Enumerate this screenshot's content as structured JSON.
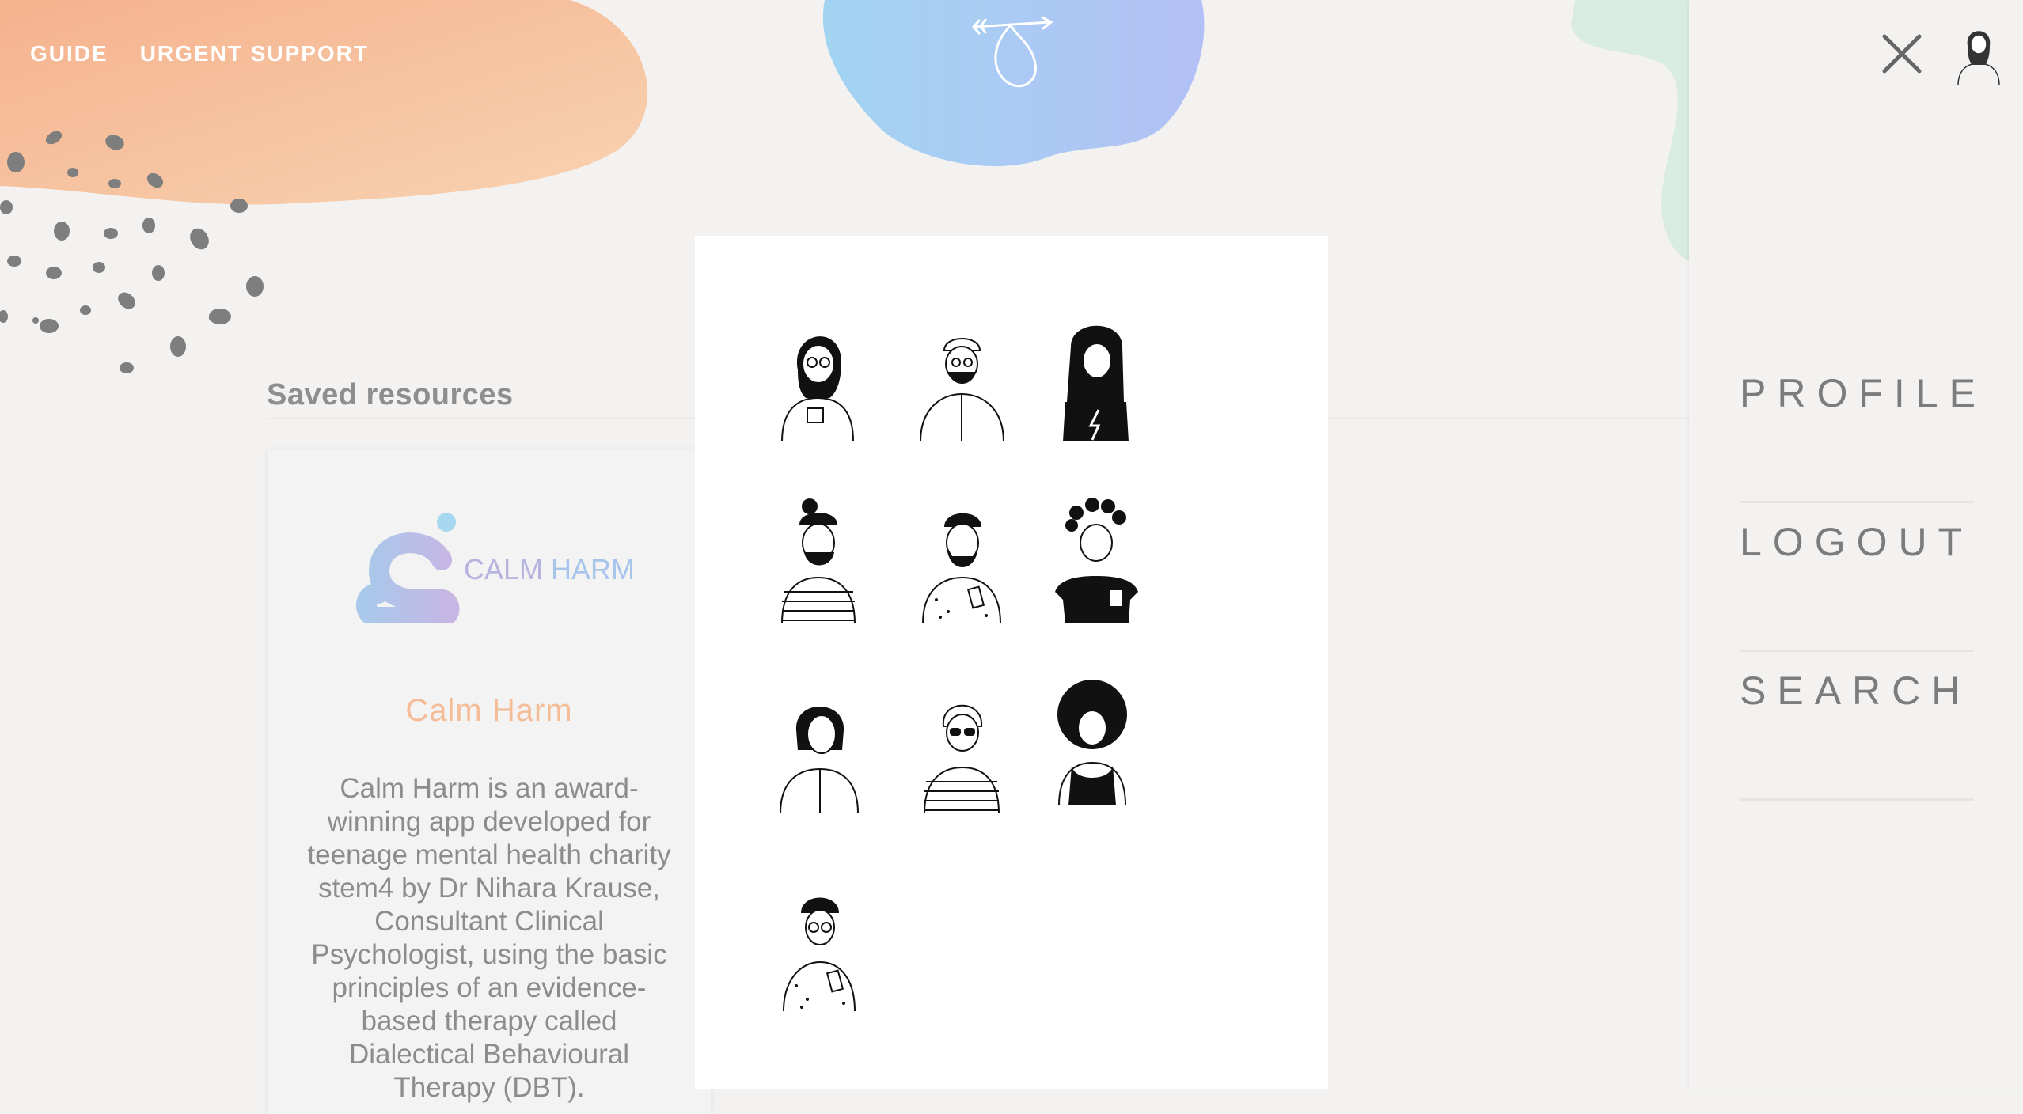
{
  "nav": {
    "guide": "GUIDE",
    "urgent_support": "URGENT SUPPORT"
  },
  "saved": {
    "title": "Saved resources"
  },
  "resource": {
    "logo_text_calm": "CALM",
    "logo_text_harm": "HARM",
    "title": "Calm Harm",
    "description": "Calm Harm is an award-winning app developed for teenage mental health charity stem4 by Dr Nihara Krause, Consultant Clinical Psychologist, using the basic principles of an evidence-based therapy called Dialectical Behavioural Therapy (DBT)."
  },
  "avatars": [
    {
      "name": "woman-hijab-glasses-mug"
    },
    {
      "name": "man-beanie-beard-glasses"
    },
    {
      "name": "woman-long-hair-lightning-tee"
    },
    {
      "name": "woman-headband-bun-striped"
    },
    {
      "name": "man-beard-phone"
    },
    {
      "name": "woman-buns-pocket-tee"
    },
    {
      "name": "woman-bob-hair-shirt"
    },
    {
      "name": "person-sunglasses-striped"
    },
    {
      "name": "woman-afro-glasses-tank"
    },
    {
      "name": "man-glasses-phone"
    }
  ],
  "side_menu": {
    "profile": "PROFILE",
    "logout": "LOGOUT",
    "search": "SEARCH"
  },
  "colors": {
    "orange_blob": "#f6c09a",
    "blue_blob": "#a6c5f3",
    "green_blob": "#cfe9dc",
    "background": "#f3f2f1",
    "title_orange": "#f5bd97"
  },
  "icons": {
    "close": "close-icon",
    "profile": "avatar-icon",
    "logo": "arrow-loop-logo-icon"
  }
}
